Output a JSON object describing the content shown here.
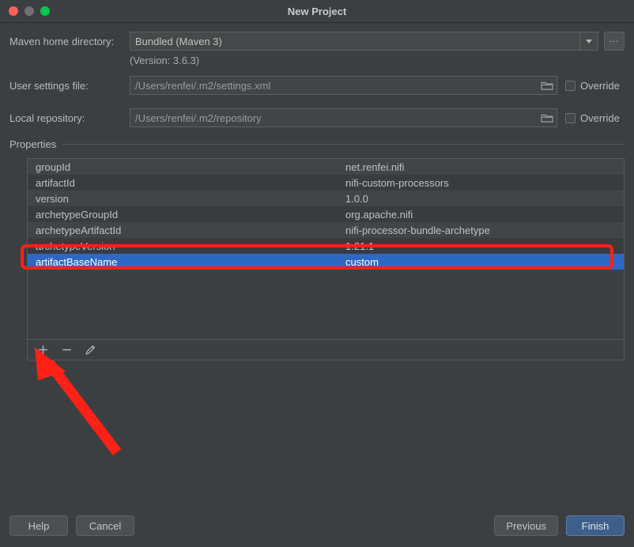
{
  "window": {
    "title": "New Project",
    "traffic_lights": [
      "close-button",
      "minimize-button",
      "maximize-button"
    ]
  },
  "form": {
    "maven_home": {
      "label": "Maven home directory:",
      "value": "Bundled (Maven 3)",
      "version_note": "(Version: 3.6.3)",
      "browse_label": "...",
      "dropdown_icon": "chevron-down-icon"
    },
    "user_settings": {
      "label": "User settings file:",
      "value": "/Users/renfei/.m2/settings.xml",
      "folder_icon": "folder-icon",
      "override_label": "Override",
      "override_checked": false
    },
    "local_repository": {
      "label": "Local repository:",
      "value": "/Users/renfei/.m2/repository",
      "folder_icon": "folder-icon",
      "override_label": "Override",
      "override_checked": false
    }
  },
  "properties": {
    "group_title": "Properties",
    "rows": [
      {
        "key": "groupId",
        "value": "net.renfei.nifi",
        "selected": false
      },
      {
        "key": "artifactId",
        "value": "nifi-custom-processors",
        "selected": false
      },
      {
        "key": "version",
        "value": "1.0.0",
        "selected": false
      },
      {
        "key": "archetypeGroupId",
        "value": "org.apache.nifi",
        "selected": false
      },
      {
        "key": "archetypeArtifactId",
        "value": "nifi-processor-bundle-archetype",
        "selected": false
      },
      {
        "key": "archetypeVersion",
        "value": "1.21.1",
        "selected": false
      },
      {
        "key": "artifactBaseName",
        "value": "custom",
        "selected": true
      }
    ],
    "toolbar": {
      "add_label": "+",
      "remove_label": "−",
      "edit_icon": "pencil-icon"
    }
  },
  "footer": {
    "help_label": "Help",
    "cancel_label": "Cancel",
    "previous_label": "Previous",
    "finish_label": "Finish"
  },
  "annotations": {
    "highlight_color": "#ff2116",
    "arrow_color": "#ff2116",
    "highlight_target": "artifactBaseName-row",
    "arrow_target": "add-property-button"
  }
}
